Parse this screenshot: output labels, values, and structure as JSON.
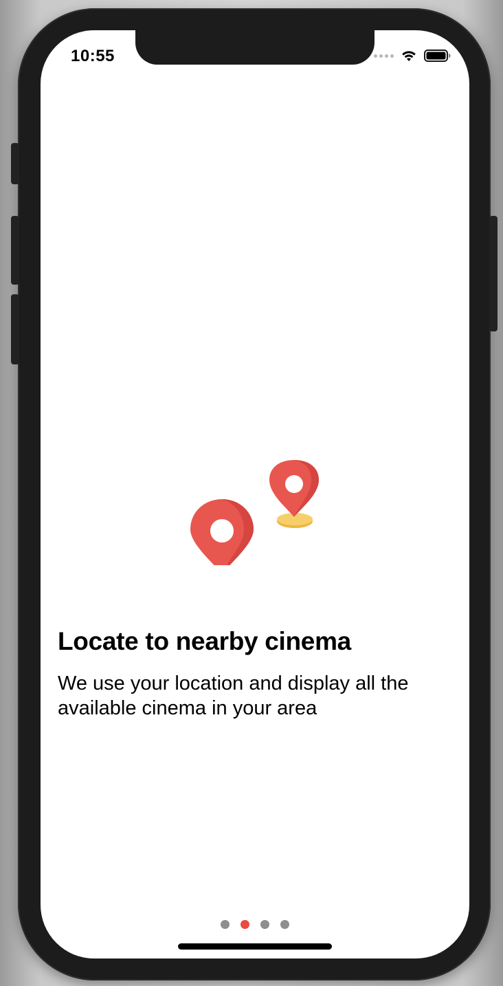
{
  "status_bar": {
    "time": "10:55",
    "icons": [
      "cellular-signal-icon",
      "wifi-icon",
      "battery-icon"
    ]
  },
  "illustration": {
    "icons": [
      "map-pin-large-icon",
      "map-pin-small-icon",
      "dashed-route-icon"
    ],
    "colors": {
      "pin": "#e8574f",
      "pin_shadow": "#d94a43",
      "base": "#f5c65a",
      "route": "#4aa3df"
    }
  },
  "onboarding": {
    "title": "Locate to nearby cinema",
    "description": "We use your location and display all the available cinema in your area"
  },
  "pager": {
    "page_count": 4,
    "current_index": 1,
    "active_color": "#ea4a3f",
    "inactive_color": "#8e8e8e"
  }
}
